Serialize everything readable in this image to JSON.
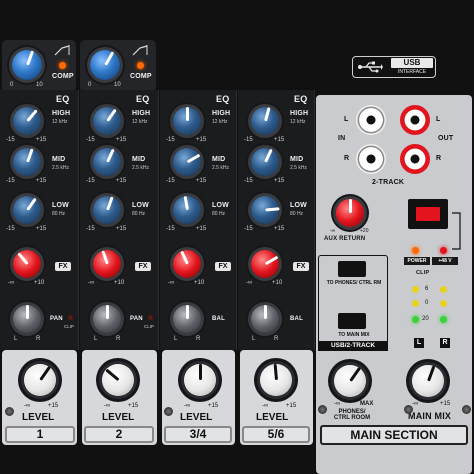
{
  "channels": [
    {
      "id": "ch1",
      "number": "1",
      "level_label": "LEVEL",
      "min": "-∞",
      "max": "+15"
    },
    {
      "id": "ch2",
      "number": "2",
      "level_label": "LEVEL",
      "min": "-∞",
      "max": "+15"
    },
    {
      "id": "ch34",
      "number": "3/4",
      "level_label": "LEVEL",
      "min": "-∞",
      "max": "+15"
    },
    {
      "id": "ch56",
      "number": "5/6",
      "level_label": "LEVEL",
      "min": "-∞",
      "max": "+15"
    }
  ],
  "comp": {
    "label": "COMP",
    "min": "0",
    "max": "10"
  },
  "eq": {
    "title": "EQ",
    "high": "HIGH",
    "high_freq": "12 kHz",
    "mid": "MID",
    "mid_freq": "2.5 kHz",
    "low": "LOW",
    "low_freq": "80 Hz",
    "range_min": "-15",
    "range_max": "+15"
  },
  "fx": {
    "label": "FX",
    "min": "-∞",
    "max": "+10"
  },
  "pan": {
    "label": "PAN",
    "bal_label": "BAL",
    "left": "L",
    "right": "R",
    "clip": "CLIP"
  },
  "usb": {
    "badge_top": "USB",
    "badge_bottom": "INTERFACE"
  },
  "main": {
    "in_label": "IN",
    "out_label": "OUT",
    "l": "L",
    "r": "R",
    "two_track": "2-TRACK",
    "aux_return": "AUX RETURN",
    "aux_min": "-∞",
    "aux_max": "+20",
    "power": "POWER",
    "phantom": "+48 V",
    "clip": "CLIP",
    "meter_6": "6",
    "meter_0": "0",
    "meter_20": "20",
    "to_phones": "TO PHONES/ CTRL RM",
    "to_main_mix": "TO MAIN MIX",
    "usb_2track": "USB/2-TRACK",
    "phones_label": "PHONES/ CTRL ROOM",
    "main_mix_label": "MAIN MIX",
    "min": "-∞",
    "max": "MAX",
    "main_max": "+15",
    "section_title": "MAIN SECTION"
  },
  "colors": {
    "accent_red": "#e3141d",
    "knob_blue": "#2e78c9",
    "led_green": "#3bd13b",
    "led_yellow": "#e8d21a",
    "led_orange": "#ff6a00"
  }
}
